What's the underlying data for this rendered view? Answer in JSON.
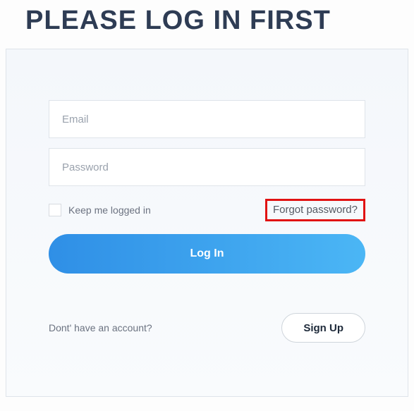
{
  "title": "PLEASE LOG IN FIRST",
  "form": {
    "email_placeholder": "Email",
    "password_placeholder": "Password",
    "keep_logged_in_label": "Keep me logged in",
    "forgot_password_label": "Forgot password?",
    "login_button_label": "Log In"
  },
  "footer": {
    "no_account_text": "Dont' have an account?",
    "signup_button_label": "Sign Up"
  }
}
